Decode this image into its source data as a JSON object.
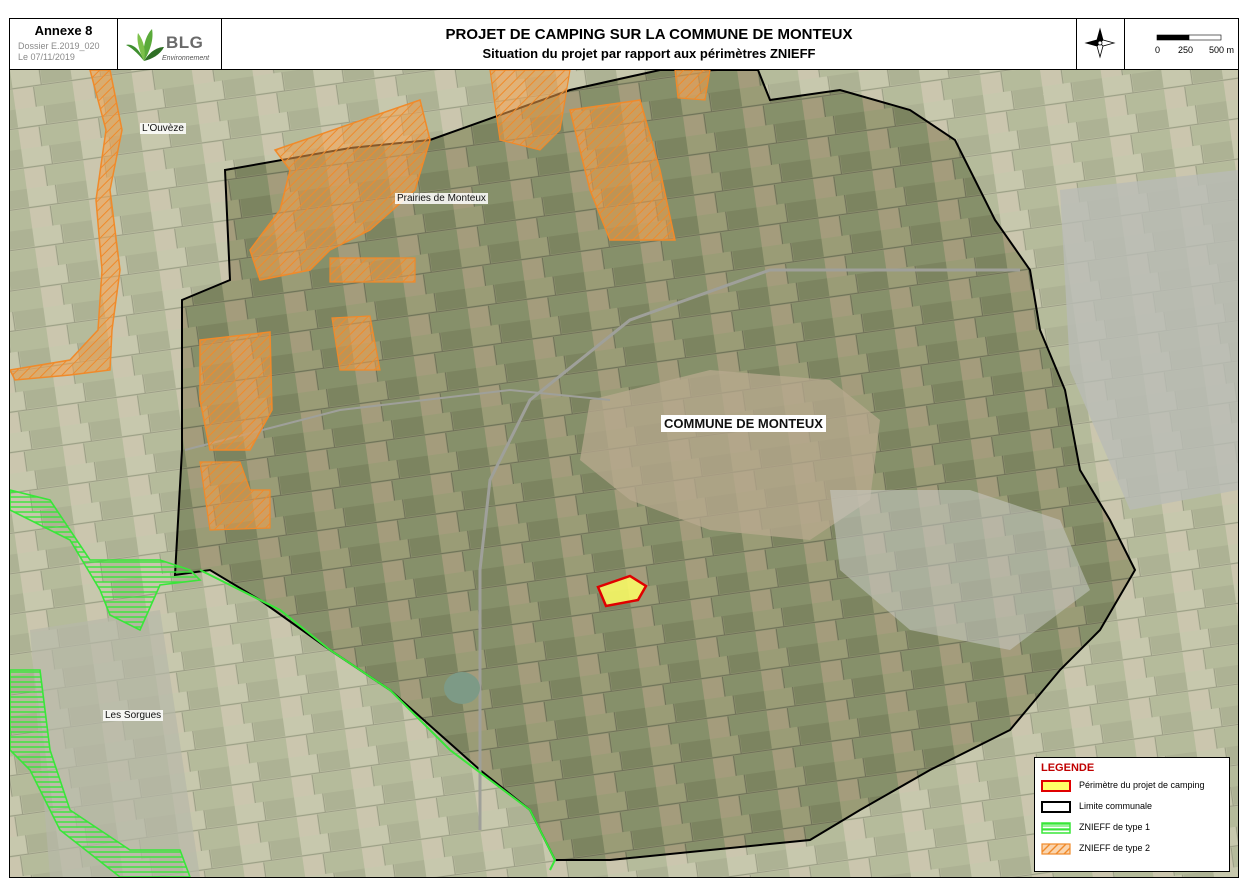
{
  "header": {
    "annex": "Annexe 8",
    "dossier": "Dossier E.2019_020",
    "date": "Le 07/11/2019",
    "logo_text": "BLG",
    "logo_sub": "Environnement",
    "title_line1": "PROJET DE CAMPING SUR LA COMMUNE DE MONTEUX",
    "title_line2": "Situation du projet par rapport aux périmètres ZNIEFF",
    "scale_labels": [
      "0",
      "250",
      "500 m"
    ]
  },
  "map": {
    "labels": {
      "ouveze": "L'Ouvèze",
      "prairies": "Prairies de Monteux",
      "commune": "COMMUNE DE MONTEUX",
      "sorgues": "Les Sorgues"
    }
  },
  "legend": {
    "title": "LEGENDE",
    "items": [
      {
        "label": "Périmètre du projet de camping",
        "color": "#ffff66",
        "border": "#e00000"
      },
      {
        "label": "Limite communale",
        "color": "#ffffff",
        "border": "#000000"
      },
      {
        "label": "ZNIEFF de type 1",
        "color": "#33dd33",
        "border": "#33dd33"
      },
      {
        "label": "ZNIEFF de type 2",
        "color": "#f0a050",
        "border": "#f0a050"
      }
    ]
  },
  "colors": {
    "znieff1": "#39e639",
    "znieff2": "#f5a04a",
    "project_fill": "#ffff66",
    "project_border": "#e00000",
    "commune_border": "#000000"
  }
}
